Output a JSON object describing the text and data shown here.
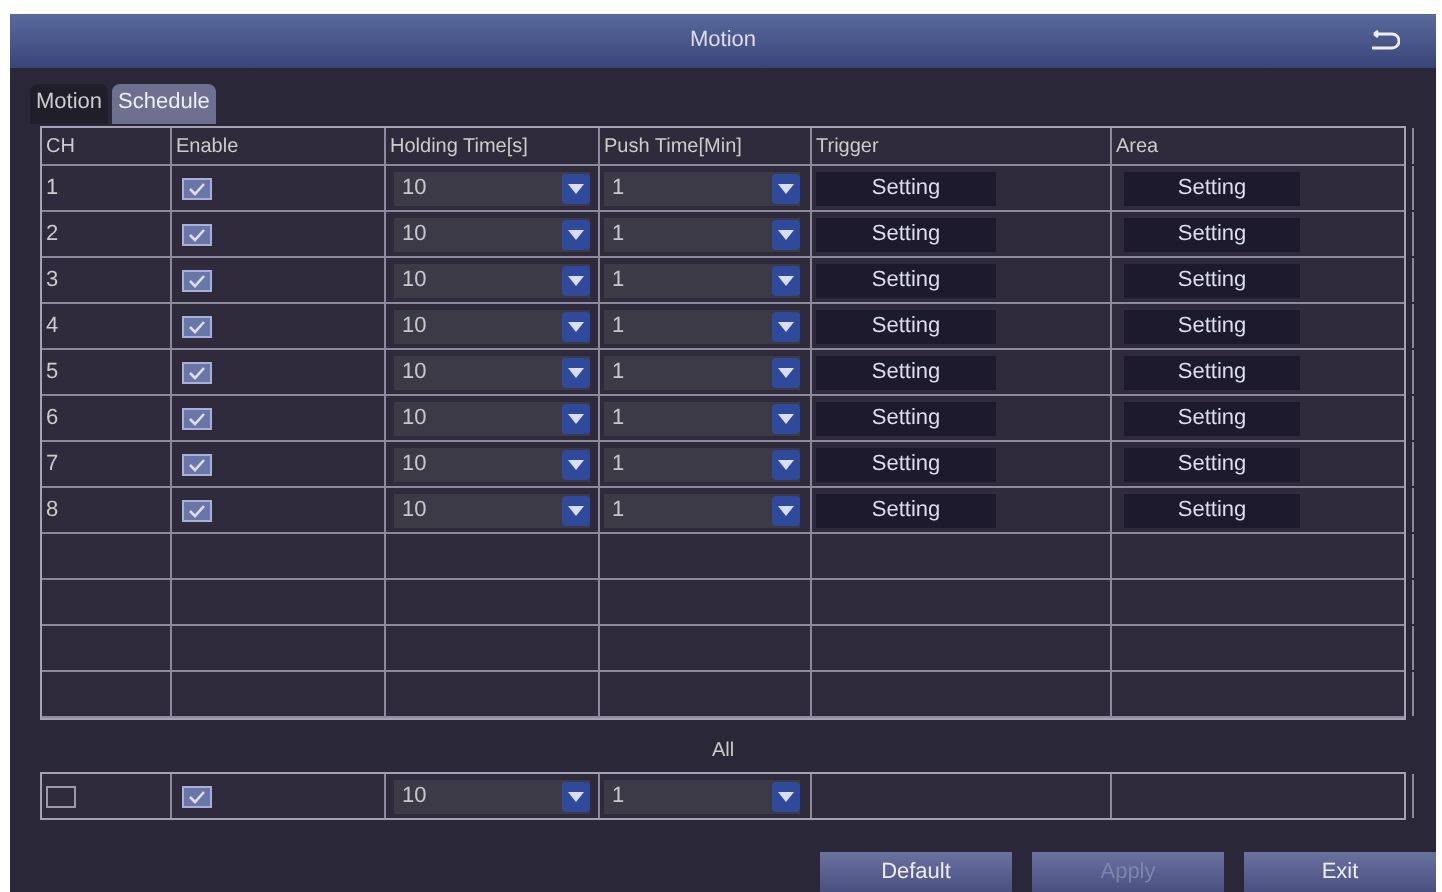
{
  "window": {
    "title": "Motion"
  },
  "tabs": [
    {
      "label": "Motion",
      "selected": false
    },
    {
      "label": "Schedule",
      "selected": true
    }
  ],
  "table": {
    "columns": [
      "CH",
      "Enable",
      "Holding Time[s]",
      "Push Time[Min]",
      "Trigger",
      "Area"
    ],
    "rows": [
      {
        "ch": "1",
        "enabled": true,
        "holding": "10",
        "push": "1",
        "trigger": "Setting",
        "area": "Setting"
      },
      {
        "ch": "2",
        "enabled": true,
        "holding": "10",
        "push": "1",
        "trigger": "Setting",
        "area": "Setting"
      },
      {
        "ch": "3",
        "enabled": true,
        "holding": "10",
        "push": "1",
        "trigger": "Setting",
        "area": "Setting"
      },
      {
        "ch": "4",
        "enabled": true,
        "holding": "10",
        "push": "1",
        "trigger": "Setting",
        "area": "Setting"
      },
      {
        "ch": "5",
        "enabled": true,
        "holding": "10",
        "push": "1",
        "trigger": "Setting",
        "area": "Setting"
      },
      {
        "ch": "6",
        "enabled": true,
        "holding": "10",
        "push": "1",
        "trigger": "Setting",
        "area": "Setting"
      },
      {
        "ch": "7",
        "enabled": true,
        "holding": "10",
        "push": "1",
        "trigger": "Setting",
        "area": "Setting"
      },
      {
        "ch": "8",
        "enabled": true,
        "holding": "10",
        "push": "1",
        "trigger": "Setting",
        "area": "Setting"
      }
    ]
  },
  "all": {
    "label": "All",
    "select_all": false,
    "enabled": true,
    "holding": "10",
    "push": "1"
  },
  "buttons": [
    {
      "label": "Default",
      "disabled": false
    },
    {
      "label": "Apply",
      "disabled": true
    },
    {
      "label": "Exit",
      "disabled": false
    }
  ]
}
